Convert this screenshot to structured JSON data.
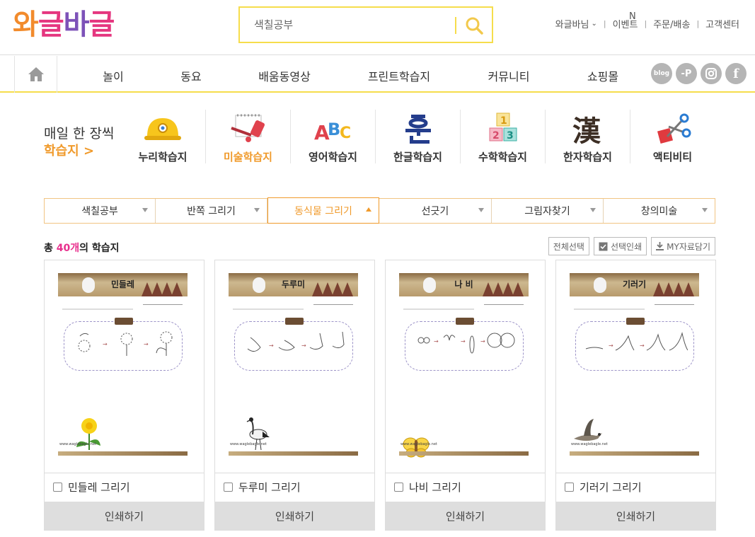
{
  "logo": {
    "chars": [
      "와",
      "글",
      "바",
      "글"
    ],
    "colors": [
      "#f28b2c",
      "#e5367f",
      "#7d52b8",
      "#e5367f"
    ]
  },
  "search": {
    "value": "색칠공부"
  },
  "top_links": [
    "와글바님",
    "이벤트",
    "주문/배송",
    "고객센터"
  ],
  "event_badge": "N",
  "nav": {
    "items": [
      "놀이",
      "동요",
      "배움동영상",
      "프린트학습지",
      "커뮤니티",
      "쇼핑몰"
    ],
    "sns": [
      "blog",
      "P",
      "instagram",
      "facebook"
    ]
  },
  "daily": {
    "line1": "매일 한 장씩",
    "line2": "학습지 >"
  },
  "categories": [
    {
      "label": "누리학습지",
      "icon": "helmet-icon"
    },
    {
      "label": "미술학습지",
      "icon": "paint-icon",
      "active": true
    },
    {
      "label": "영어학습지",
      "icon": "abc-icon"
    },
    {
      "label": "한글학습지",
      "icon": "hangul-icon"
    },
    {
      "label": "수학학습지",
      "icon": "numbers-icon"
    },
    {
      "label": "한자학습지",
      "icon": "hanja-icon"
    },
    {
      "label": "액티비티",
      "icon": "scissors-icon"
    }
  ],
  "tabs": [
    {
      "label": "색칠공부"
    },
    {
      "label": "반쪽 그리기"
    },
    {
      "label": "동식물 그리기",
      "active": true
    },
    {
      "label": "선긋기"
    },
    {
      "label": "그림자찾기"
    },
    {
      "label": "창의미술"
    }
  ],
  "list": {
    "total_prefix": "총 ",
    "count": "40개",
    "total_suffix": "의 학습지"
  },
  "actions": [
    "전체선택",
    "선택인쇄",
    "MY자료담기"
  ],
  "cards": [
    {
      "thumb_title": "민들레",
      "label": "민들레 그리기",
      "print": "인쇄하기"
    },
    {
      "thumb_title": "두루미",
      "label": "두루미 그리기",
      "print": "인쇄하기"
    },
    {
      "thumb_title": "나 비",
      "label": "나비 그리기",
      "print": "인쇄하기"
    },
    {
      "thumb_title": "기러기",
      "label": "기러기 그리기",
      "print": "인쇄하기"
    }
  ],
  "thumb_url": "www.waglebagle.net",
  "colors": {
    "accent": "#f09a2b",
    "yellow": "#f6dd4c",
    "pink": "#e8308d"
  }
}
